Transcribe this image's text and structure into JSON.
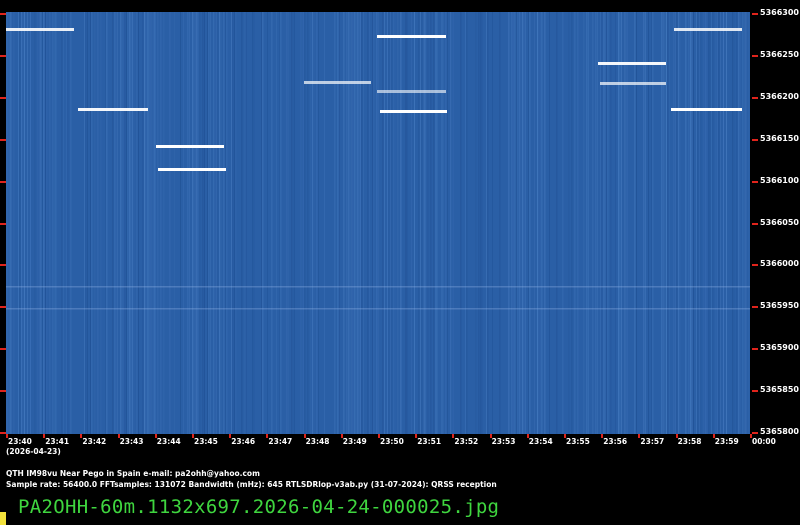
{
  "colors": {
    "background": "#000000",
    "waterfall": "#2a5fa6",
    "tick": "#e0241c",
    "filename_text": "#3fd63f",
    "marker": "#f3e23c"
  },
  "freq_axis": {
    "labels": [
      "5366300",
      "5366250",
      "5366200",
      "5366150",
      "5366100",
      "5366050",
      "5366000",
      "5365950",
      "5365900",
      "5365850",
      "5365800"
    ]
  },
  "time_axis": {
    "labels": [
      "23:40",
      "23:41",
      "23:42",
      "23:43",
      "23:44",
      "23:45",
      "23:46",
      "23:47",
      "23:48",
      "23:49",
      "23:50",
      "23:51",
      "23:52",
      "23:53",
      "23:54",
      "23:55",
      "23:56",
      "23:57",
      "23:58",
      "23:59",
      "00:00"
    ],
    "date": "(2026-04-23)"
  },
  "info": {
    "line1": "QTH IM98vu Near Pego in Spain   e-mail: pa2ohh@yahoo.com",
    "line2": "Sample rate: 56400.0    FFTsamples: 131072    Bandwidth (mHz): 645           RTLSDRlop-v3ab.py (31-07-2024): QRSS reception"
  },
  "filename": "PA2OHH-60m.1132x697.2026-04-24-000025.jpg"
}
